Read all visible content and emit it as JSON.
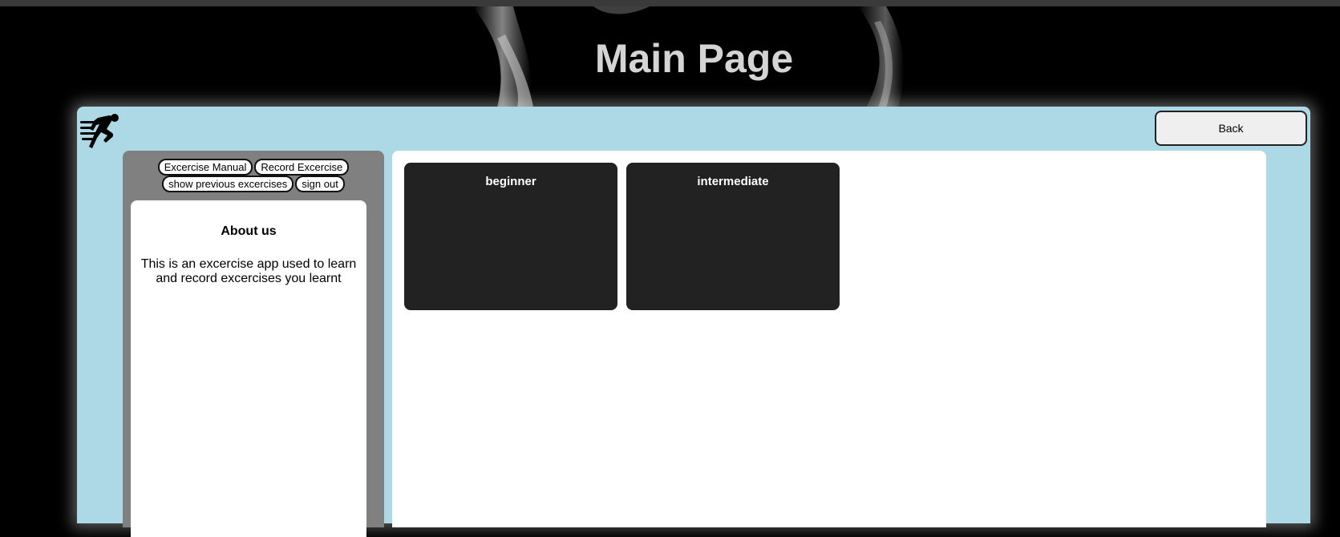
{
  "header": {
    "title": "Main Page"
  },
  "toolbar": {
    "back_label": "Back"
  },
  "nav": {
    "items": [
      {
        "label": "Excercise Manual"
      },
      {
        "label": "Record Excercise"
      },
      {
        "label": "show previous excercises"
      },
      {
        "label": "sign out"
      }
    ]
  },
  "about": {
    "title": "About us",
    "text": "This is an excercise app used to learn and record excercises you learnt"
  },
  "levels": [
    {
      "label": "beginner"
    },
    {
      "label": "intermediate"
    }
  ],
  "icons": {
    "logo": "running-person-icon"
  },
  "colors": {
    "panel": "#add8e6",
    "sidebar": "#808080",
    "card": "#222222",
    "title": "#d4d4d4"
  }
}
